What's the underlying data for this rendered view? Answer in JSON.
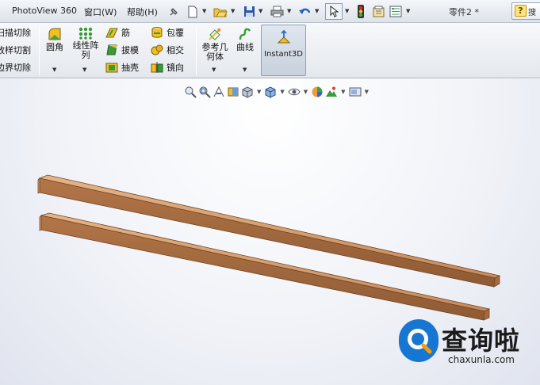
{
  "menubar": {
    "items": [
      "PhotoView 360",
      "窗口(W)",
      "帮助(H)"
    ],
    "doc_title": "零件2 *",
    "help_search_label": "搜"
  },
  "ribbon": {
    "cut_tools": [
      "扫描切除",
      "放样切割",
      "边界切除"
    ],
    "fillet_label": "圆角",
    "linear_pattern_label": "线性阵\n列",
    "rib_label": "筋",
    "draft_label": "拔模",
    "shell_label": "抽壳",
    "wrap_label": "包覆",
    "intersect_label": "相交",
    "mirror_label": "镜向",
    "ref_geometry_label": "参考几\n何体",
    "curves_label": "曲线",
    "instant3d_label": "Instant3D"
  },
  "watermark": {
    "title": "查询啦",
    "site": "chaxunla.com"
  },
  "colors": {
    "accent_blue": "#1876d3",
    "wood": "#c8875a"
  }
}
